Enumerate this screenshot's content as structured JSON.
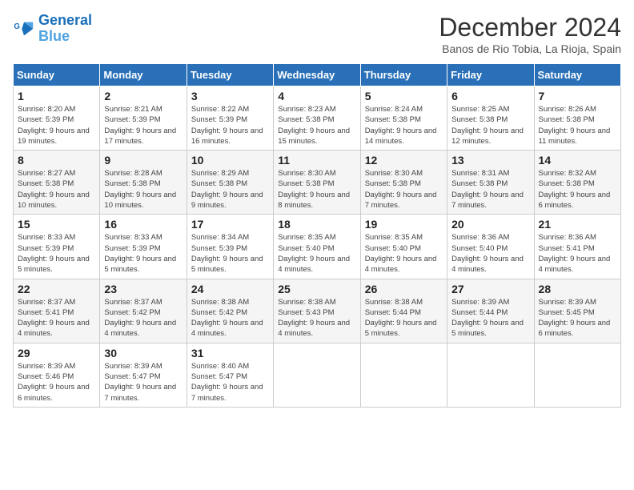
{
  "logo": {
    "line1": "General",
    "line2": "Blue"
  },
  "title": "December 2024",
  "location": "Banos de Rio Tobia, La Rioja, Spain",
  "weekdays": [
    "Sunday",
    "Monday",
    "Tuesday",
    "Wednesday",
    "Thursday",
    "Friday",
    "Saturday"
  ],
  "weeks": [
    [
      {
        "day": "1",
        "info": "Sunrise: 8:20 AM\nSunset: 5:39 PM\nDaylight: 9 hours and 19 minutes."
      },
      {
        "day": "2",
        "info": "Sunrise: 8:21 AM\nSunset: 5:39 PM\nDaylight: 9 hours and 17 minutes."
      },
      {
        "day": "3",
        "info": "Sunrise: 8:22 AM\nSunset: 5:39 PM\nDaylight: 9 hours and 16 minutes."
      },
      {
        "day": "4",
        "info": "Sunrise: 8:23 AM\nSunset: 5:38 PM\nDaylight: 9 hours and 15 minutes."
      },
      {
        "day": "5",
        "info": "Sunrise: 8:24 AM\nSunset: 5:38 PM\nDaylight: 9 hours and 14 minutes."
      },
      {
        "day": "6",
        "info": "Sunrise: 8:25 AM\nSunset: 5:38 PM\nDaylight: 9 hours and 12 minutes."
      },
      {
        "day": "7",
        "info": "Sunrise: 8:26 AM\nSunset: 5:38 PM\nDaylight: 9 hours and 11 minutes."
      }
    ],
    [
      {
        "day": "8",
        "info": "Sunrise: 8:27 AM\nSunset: 5:38 PM\nDaylight: 9 hours and 10 minutes."
      },
      {
        "day": "9",
        "info": "Sunrise: 8:28 AM\nSunset: 5:38 PM\nDaylight: 9 hours and 10 minutes."
      },
      {
        "day": "10",
        "info": "Sunrise: 8:29 AM\nSunset: 5:38 PM\nDaylight: 9 hours and 9 minutes."
      },
      {
        "day": "11",
        "info": "Sunrise: 8:30 AM\nSunset: 5:38 PM\nDaylight: 9 hours and 8 minutes."
      },
      {
        "day": "12",
        "info": "Sunrise: 8:30 AM\nSunset: 5:38 PM\nDaylight: 9 hours and 7 minutes."
      },
      {
        "day": "13",
        "info": "Sunrise: 8:31 AM\nSunset: 5:38 PM\nDaylight: 9 hours and 7 minutes."
      },
      {
        "day": "14",
        "info": "Sunrise: 8:32 AM\nSunset: 5:38 PM\nDaylight: 9 hours and 6 minutes."
      }
    ],
    [
      {
        "day": "15",
        "info": "Sunrise: 8:33 AM\nSunset: 5:39 PM\nDaylight: 9 hours and 5 minutes."
      },
      {
        "day": "16",
        "info": "Sunrise: 8:33 AM\nSunset: 5:39 PM\nDaylight: 9 hours and 5 minutes."
      },
      {
        "day": "17",
        "info": "Sunrise: 8:34 AM\nSunset: 5:39 PM\nDaylight: 9 hours and 5 minutes."
      },
      {
        "day": "18",
        "info": "Sunrise: 8:35 AM\nSunset: 5:40 PM\nDaylight: 9 hours and 4 minutes."
      },
      {
        "day": "19",
        "info": "Sunrise: 8:35 AM\nSunset: 5:40 PM\nDaylight: 9 hours and 4 minutes."
      },
      {
        "day": "20",
        "info": "Sunrise: 8:36 AM\nSunset: 5:40 PM\nDaylight: 9 hours and 4 minutes."
      },
      {
        "day": "21",
        "info": "Sunrise: 8:36 AM\nSunset: 5:41 PM\nDaylight: 9 hours and 4 minutes."
      }
    ],
    [
      {
        "day": "22",
        "info": "Sunrise: 8:37 AM\nSunset: 5:41 PM\nDaylight: 9 hours and 4 minutes."
      },
      {
        "day": "23",
        "info": "Sunrise: 8:37 AM\nSunset: 5:42 PM\nDaylight: 9 hours and 4 minutes."
      },
      {
        "day": "24",
        "info": "Sunrise: 8:38 AM\nSunset: 5:42 PM\nDaylight: 9 hours and 4 minutes."
      },
      {
        "day": "25",
        "info": "Sunrise: 8:38 AM\nSunset: 5:43 PM\nDaylight: 9 hours and 4 minutes."
      },
      {
        "day": "26",
        "info": "Sunrise: 8:38 AM\nSunset: 5:44 PM\nDaylight: 9 hours and 5 minutes."
      },
      {
        "day": "27",
        "info": "Sunrise: 8:39 AM\nSunset: 5:44 PM\nDaylight: 9 hours and 5 minutes."
      },
      {
        "day": "28",
        "info": "Sunrise: 8:39 AM\nSunset: 5:45 PM\nDaylight: 9 hours and 6 minutes."
      }
    ],
    [
      {
        "day": "29",
        "info": "Sunrise: 8:39 AM\nSunset: 5:46 PM\nDaylight: 9 hours and 6 minutes."
      },
      {
        "day": "30",
        "info": "Sunrise: 8:39 AM\nSunset: 5:47 PM\nDaylight: 9 hours and 7 minutes."
      },
      {
        "day": "31",
        "info": "Sunrise: 8:40 AM\nSunset: 5:47 PM\nDaylight: 9 hours and 7 minutes."
      },
      {
        "day": "",
        "info": ""
      },
      {
        "day": "",
        "info": ""
      },
      {
        "day": "",
        "info": ""
      },
      {
        "day": "",
        "info": ""
      }
    ]
  ]
}
